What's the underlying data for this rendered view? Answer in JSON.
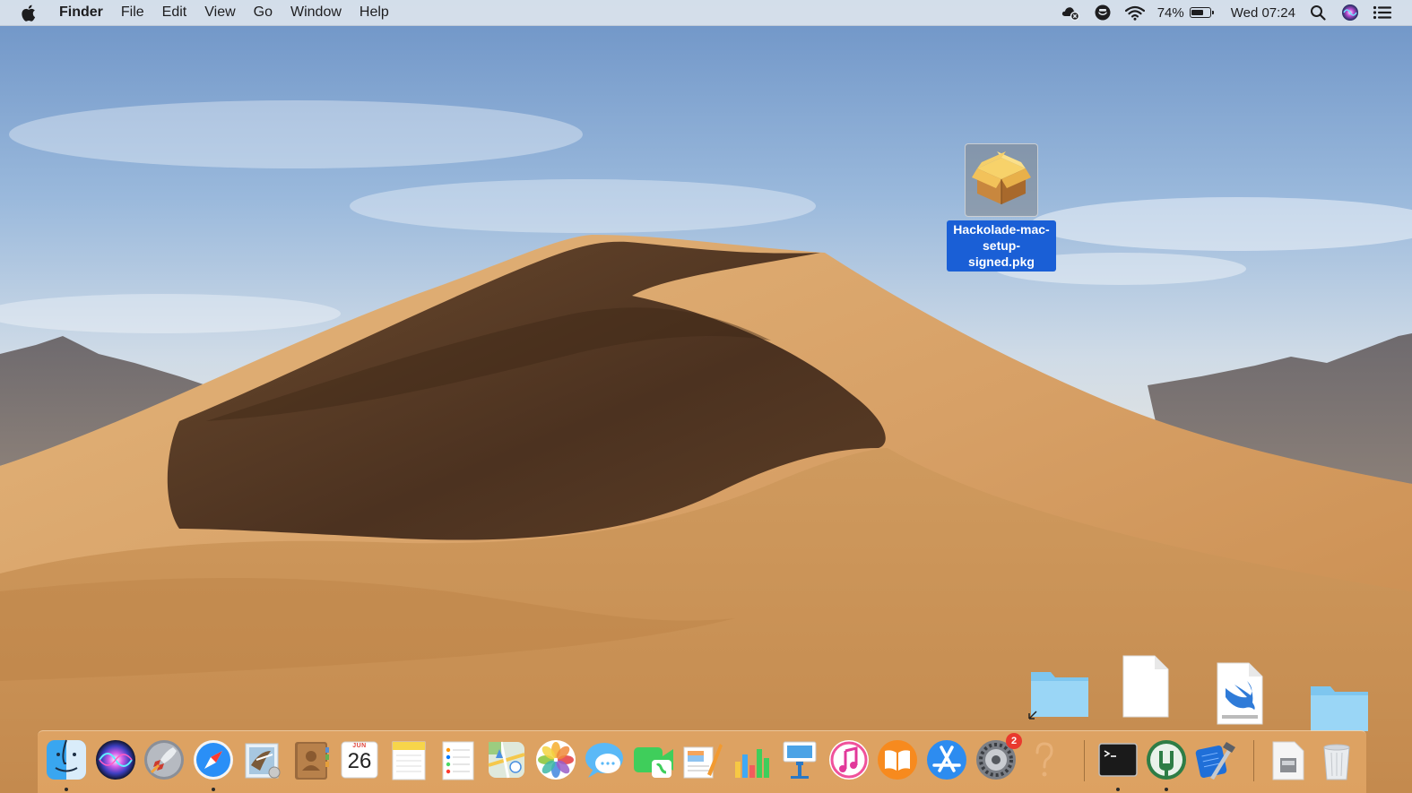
{
  "menubar": {
    "app_name": "Finder",
    "menus": [
      "File",
      "Edit",
      "View",
      "Go",
      "Window",
      "Help"
    ],
    "battery_percent": "74%",
    "battery_level": 0.74,
    "clock": "Wed 07:24"
  },
  "desktop": {
    "selected_file_label": "Hackolade-mac-setup-signed.pkg",
    "selected_file_line1": "Hackolade-mac-",
    "selected_file_line2": "setup-signed.pkg"
  },
  "dock": {
    "calendar_month": "JUN",
    "calendar_day": "26",
    "system_preferences_badge": "2"
  },
  "colors": {
    "selection_blue": "#1a5fd6",
    "badge_red": "#e9392e"
  }
}
